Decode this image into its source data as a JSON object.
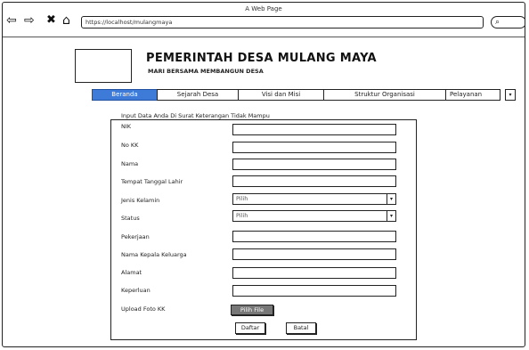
{
  "browser": {
    "window_title": "A Web Page",
    "url": "https://localhost/mulangmaya",
    "nav": {
      "back": "⇦",
      "forward": "⇨",
      "close": "✖",
      "home": "⌂"
    },
    "search_icon": "⌕"
  },
  "site": {
    "title": "PEMERINTAH DESA MULANG MAYA",
    "subtitle": "MARI BERSAMA MEMBANGUN DESA"
  },
  "menu": {
    "items": [
      {
        "label": "Beranda"
      },
      {
        "label": "Sejarah Desa"
      },
      {
        "label": "Visi dan Misi"
      },
      {
        "label": "Struktur Organisasi"
      },
      {
        "label": "Pelayanan"
      }
    ],
    "caret": "▾"
  },
  "form": {
    "heading": "Input Data Anda Di Surat Keterangan Tidak Mampu",
    "fields": [
      {
        "label": "NIK"
      },
      {
        "label": "No KK"
      },
      {
        "label": "Nama"
      },
      {
        "label": "Tempat Tanggal Lahir"
      },
      {
        "label": "Jenis Kelamin",
        "value": "Pilih"
      },
      {
        "label": "Status",
        "value": "Pilih"
      },
      {
        "label": "Pekerjaan"
      },
      {
        "label": "Nama Kepala Keluarga"
      },
      {
        "label": "Alamat"
      },
      {
        "label": "Keperluan"
      },
      {
        "label": "Upload Foto KK"
      }
    ],
    "file_button": "Pilih File",
    "submit_button": "Daftar",
    "cancel_button": "Batal",
    "select_caret": "▾"
  },
  "colors": {
    "active_menu": "#3e7bd9",
    "file_button": "#777777"
  }
}
